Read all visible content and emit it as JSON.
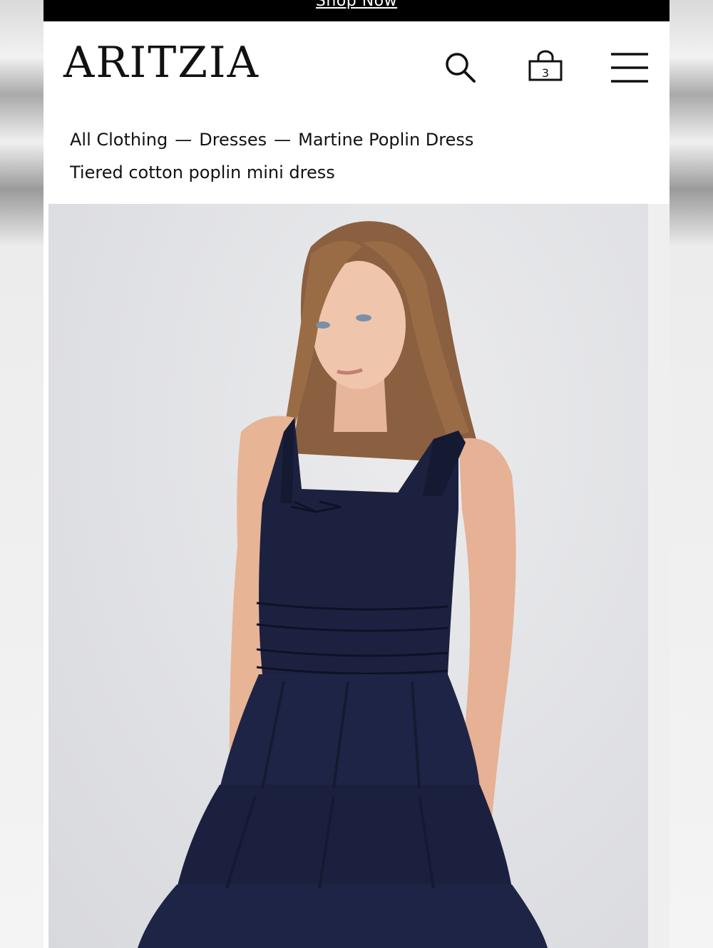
{
  "promo": {
    "link_label": "Shop Now"
  },
  "header": {
    "logo": "ARITZIA",
    "bag_count": "3"
  },
  "breadcrumb": {
    "items": [
      "All Clothing",
      "Dresses",
      "Martine Poplin Dress"
    ],
    "separator": "—"
  },
  "product": {
    "subtitle": "Tiered cotton poplin mini dress",
    "dress_color": "#1c2140"
  },
  "colors": {
    "promo_bg": "#000000",
    "text": "#111111",
    "background": "#ffffff"
  },
  "icons": [
    "search-icon",
    "bag-icon",
    "menu-icon"
  ]
}
